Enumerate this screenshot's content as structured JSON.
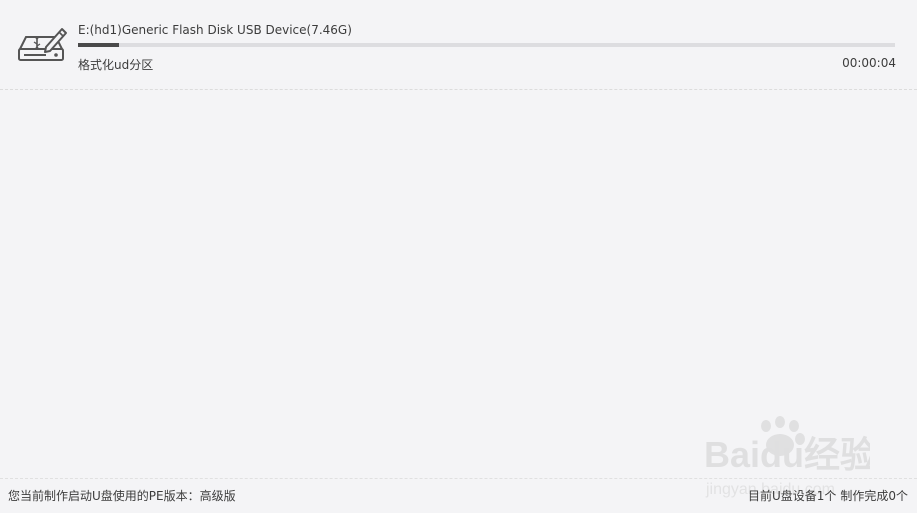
{
  "device": {
    "icon": "usb-drive-edit-icon",
    "name": "E:(hd1)Generic Flash Disk USB Device(7.46G)",
    "progress_percent": 5,
    "status": "格式化ud分区",
    "elapsed": "00:00:04"
  },
  "footer": {
    "pe_version_text": "您当前制作启动U盘使用的PE版本：高级版",
    "device_count_text": "目前U盘设备1个",
    "completed_count_text": "制作完成0个"
  },
  "watermark": {
    "brand": "Baidu经验",
    "url": "jingyan.baidu.com"
  },
  "colors": {
    "background": "#f4f4f6",
    "progress_fill": "#4a4a4a",
    "progress_track": "#dddde0",
    "text": "#3c3c3c"
  }
}
